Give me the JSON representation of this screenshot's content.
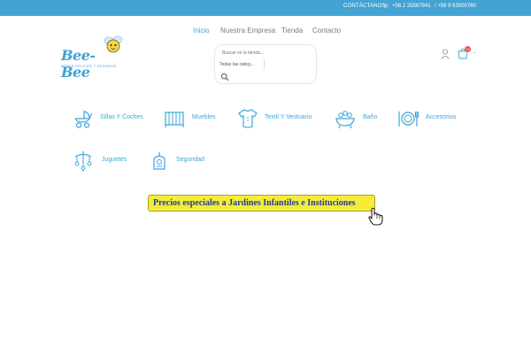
{
  "topbar": {
    "contact_label": "CONTÁCTANOS",
    "phone_1": "+56 2 25567941",
    "phone_2": "/ +56 9 63000760"
  },
  "nav": {
    "items": [
      "Inicio",
      "Nuestra Empresa",
      "Tienda",
      "Contacto"
    ],
    "active": "Inicio"
  },
  "logo": {
    "name": "Bee-Bee",
    "tagline": "BEBÉS FELICES Y SEGUROS"
  },
  "search": {
    "placeholder": "Buscar en la tienda...",
    "category_select": "Todas las categ..."
  },
  "cart": {
    "count": "0"
  },
  "categories": [
    {
      "label": "Sillas Y Coches",
      "icon": "stroller-icon"
    },
    {
      "label": "Muebles",
      "icon": "crib-icon"
    },
    {
      "label": "Textil Y Vestuario",
      "icon": "onesie-icon"
    },
    {
      "label": "Baño",
      "icon": "bathtub-icon"
    },
    {
      "label": "Accesorios",
      "icon": "feeding-icon"
    },
    {
      "label": "Juguetes",
      "icon": "mobile-toy-icon"
    },
    {
      "label": "Seguridad",
      "icon": "baby-monitor-icon"
    }
  ],
  "promo": {
    "text": "Precios especiales a Jardines Infantiles e Instituciones"
  },
  "colors": {
    "topbar": "#42a3d4",
    "accent": "#3ca7d8",
    "promo_bg": "#f5ec3a",
    "promo_text": "#1f3d9c",
    "badge": "#e85a5a"
  }
}
